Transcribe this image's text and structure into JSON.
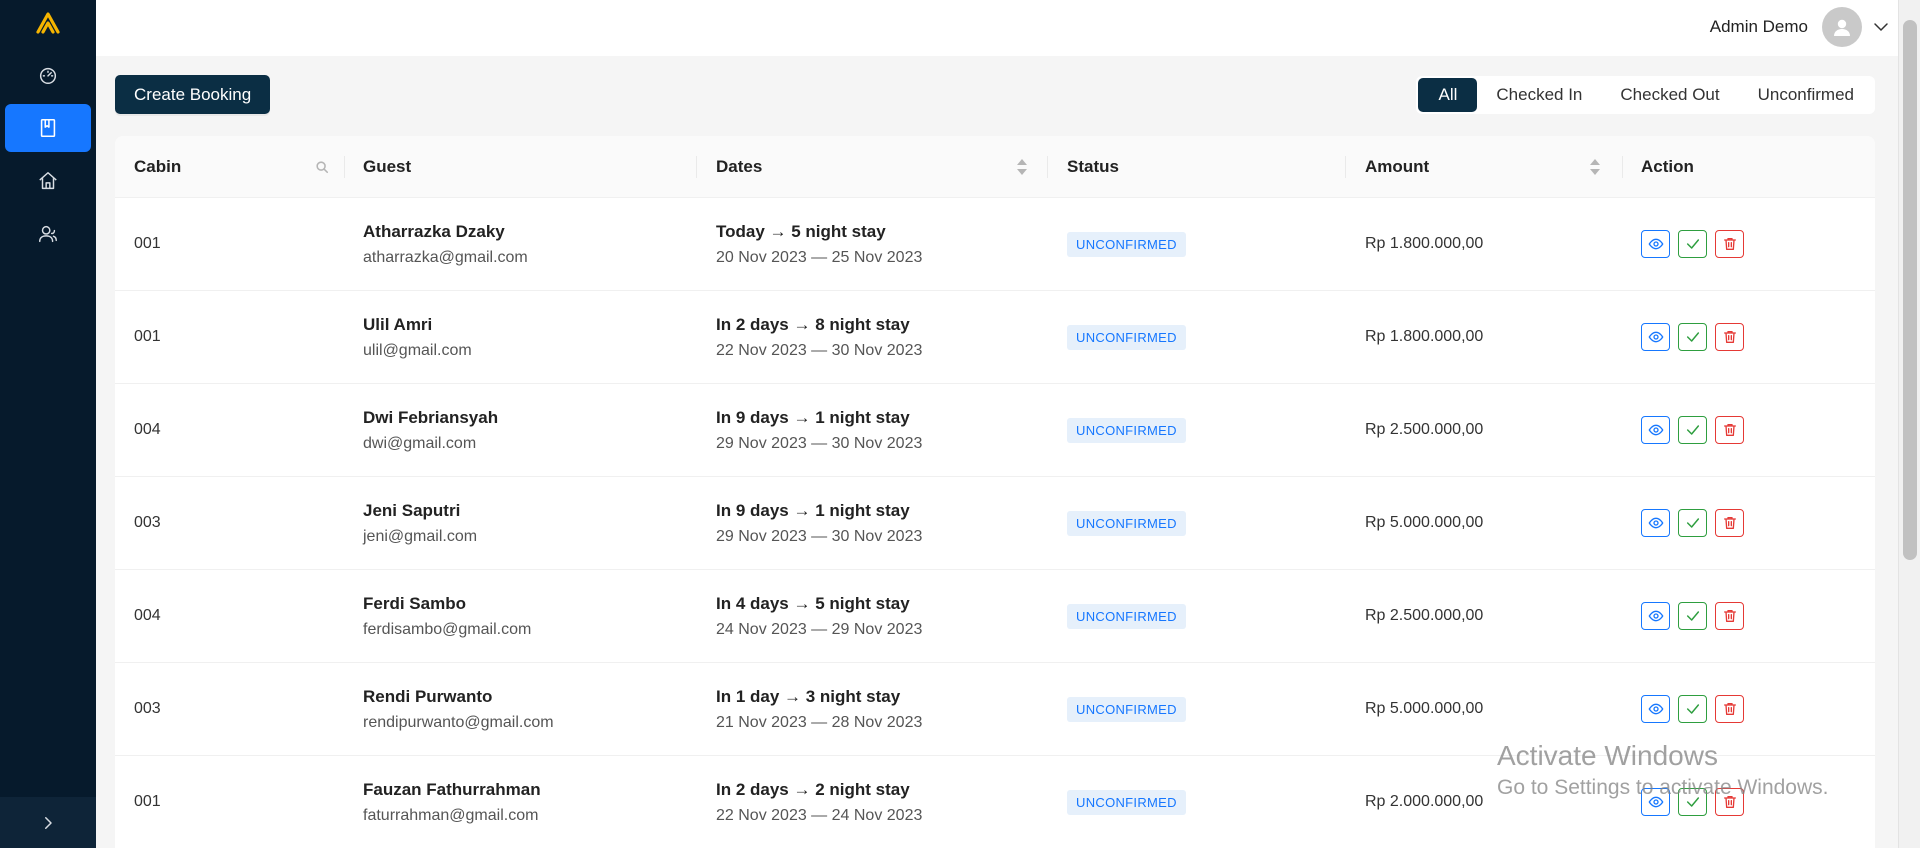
{
  "sidebar": {
    "items": [
      {
        "icon": "dashboard-icon",
        "active": false
      },
      {
        "icon": "bookings-icon",
        "active": true
      },
      {
        "icon": "cabins-icon",
        "active": false
      },
      {
        "icon": "users-icon",
        "active": false
      }
    ],
    "collapse_icon": "chevron-right-icon"
  },
  "header": {
    "user_name": "Admin Demo"
  },
  "toolbar": {
    "create_label": "Create Booking",
    "filters": [
      "All",
      "Checked In",
      "Checked Out",
      "Unconfirmed"
    ],
    "active_filter": "All"
  },
  "table": {
    "columns": [
      "Cabin",
      "Guest",
      "Dates",
      "Status",
      "Amount",
      "Action"
    ],
    "rows": [
      {
        "cabin": "001",
        "name": "Atharrazka Dzaky",
        "email": "atharrazka@gmail.com",
        "stay": "Today → 5 night stay",
        "range": "20 Nov 2023 — 25 Nov 2023",
        "status": "UNCONFIRMED",
        "amount": "Rp 1.800.000,00"
      },
      {
        "cabin": "001",
        "name": "Ulil Amri",
        "email": "ulil@gmail.com",
        "stay": "In 2 days → 8 night stay",
        "range": "22 Nov 2023 — 30 Nov 2023",
        "status": "UNCONFIRMED",
        "amount": "Rp 1.800.000,00"
      },
      {
        "cabin": "004",
        "name": "Dwi Febriansyah",
        "email": "dwi@gmail.com",
        "stay": "In 9 days → 1 night stay",
        "range": "29 Nov 2023 — 30 Nov 2023",
        "status": "UNCONFIRMED",
        "amount": "Rp 2.500.000,00"
      },
      {
        "cabin": "003",
        "name": "Jeni Saputri",
        "email": "jeni@gmail.com",
        "stay": "In 9 days → 1 night stay",
        "range": "29 Nov 2023 — 30 Nov 2023",
        "status": "UNCONFIRMED",
        "amount": "Rp 5.000.000,00"
      },
      {
        "cabin": "004",
        "name": "Ferdi Sambo",
        "email": "ferdisambo@gmail.com",
        "stay": "In 4 days → 5 night stay",
        "range": "24 Nov 2023 — 29 Nov 2023",
        "status": "UNCONFIRMED",
        "amount": "Rp 2.500.000,00"
      },
      {
        "cabin": "003",
        "name": "Rendi Purwanto",
        "email": "rendipurwanto@gmail.com",
        "stay": "In 1 day → 3 night stay",
        "range": "21 Nov 2023 — 28 Nov 2023",
        "status": "UNCONFIRMED",
        "amount": "Rp 5.000.000,00"
      },
      {
        "cabin": "001",
        "name": "Fauzan Fathurrahman",
        "email": "faturrahman@gmail.com",
        "stay": "In 2 days → 2 night stay",
        "range": "22 Nov 2023 — 24 Nov 2023",
        "status": "UNCONFIRMED",
        "amount": "Rp 2.000.000,00"
      }
    ]
  },
  "watermark": {
    "line1": "Activate Windows",
    "line2": "Go to Settings to activate Windows."
  },
  "colors": {
    "sidebar": "#061a2c",
    "primary_dark": "#0b2e44",
    "accent": "#1677ff",
    "logo": "#f5b400",
    "success": "#2e9e3f",
    "danger": "#e53935"
  }
}
